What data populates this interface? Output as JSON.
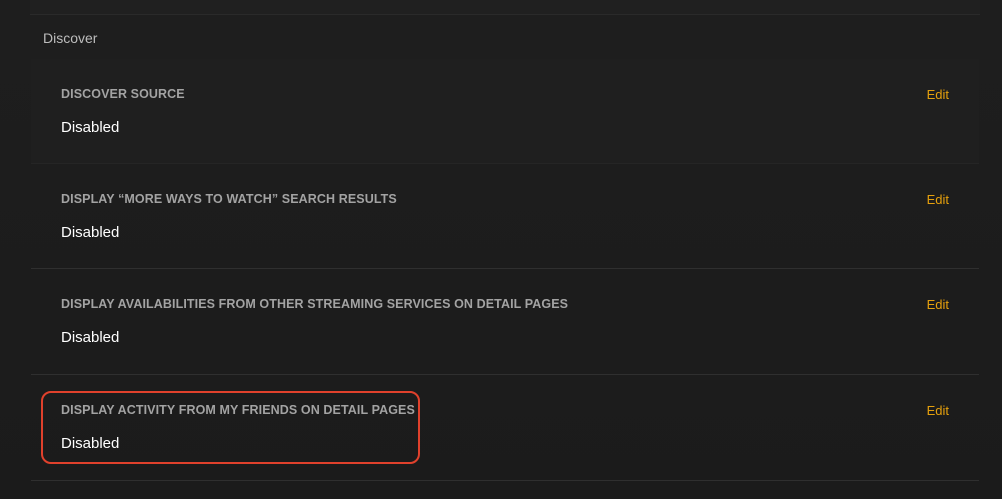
{
  "section": {
    "title": "Discover"
  },
  "settings": [
    {
      "label": "DISCOVER SOURCE",
      "value": "Disabled",
      "edit_label": "Edit"
    },
    {
      "label": "DISPLAY “MORE WAYS TO WATCH” SEARCH RESULTS",
      "value": "Disabled",
      "edit_label": "Edit"
    },
    {
      "label": "DISPLAY AVAILABILITIES FROM OTHER STREAMING SERVICES ON DETAIL PAGES",
      "value": "Disabled",
      "edit_label": "Edit"
    },
    {
      "label": "DISPLAY ACTIVITY FROM MY FRIENDS ON DETAIL PAGES",
      "value": "Disabled",
      "edit_label": "Edit"
    }
  ],
  "colors": {
    "accent": "#e5a00d",
    "highlight": "#e0412c",
    "background": "#1c1c1c"
  }
}
